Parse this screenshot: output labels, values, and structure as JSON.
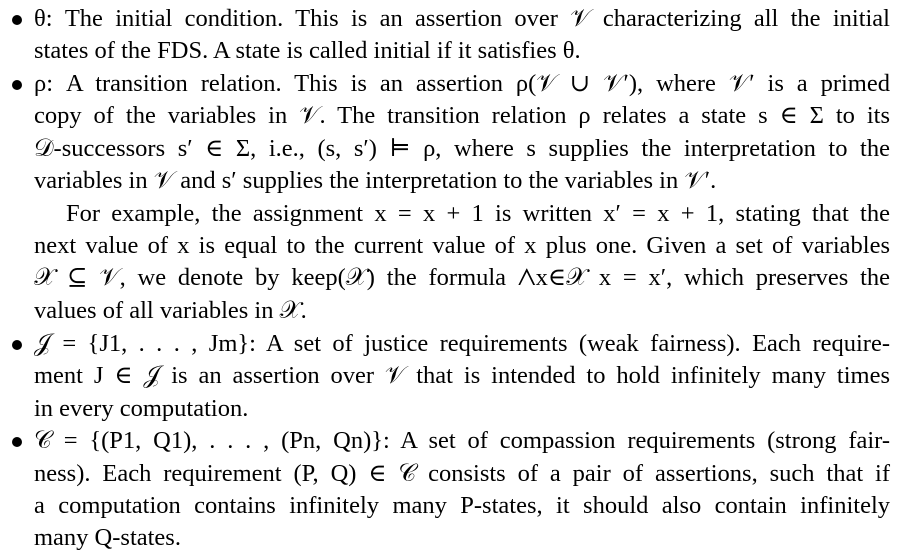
{
  "document": {
    "lines": [
      "θ: The initial condition. This is an assertion over 𝒱 characterizing all the initial",
      "states of the FDS. A state is called initial if it satisfies θ.",
      "ρ: A transition relation. This is an assertion ρ(𝒱 ∪ 𝒱′), where 𝒱′ is a primed",
      "copy of the variables in 𝒱. The transition relation ρ relates a state s ∈ Σ to its",
      "𝒟-successors s′ ∈ Σ, i.e., (s, s′) ⊨ ρ, where s supplies the interpretation to the",
      "variables in 𝒱 and s′ supplies the interpretation to the variables in 𝒱′.",
      "For example, the assignment x = x + 1 is written x′ = x + 1, stating that the",
      "next value of x is equal to the current value of x plus one. Given a set of variables",
      "𝒳 ⊆ 𝒱, we denote by keep(𝒳) the formula ⋀x∈𝒳 x = x′, which preserves the",
      "values of all variables in 𝒳.",
      "𝒥 = {J1, . . . , Jm}: A set of justice requirements (weak fairness). Each require-",
      "ment J ∈ 𝒥 is an assertion over 𝒱 that is intended to hold infinitely many times",
      "in every computation.",
      "𝒞 = {(P1, Q1), . . . , (Pn, Qn)}: A set of compassion requirements (strong fair-",
      "ness). Each requirement (P, Q) ∈ 𝒞 consists of a pair of assertions, such that if",
      "a computation contains infinitely many P-states, it should also contain infinitely",
      "many Q-states."
    ]
  }
}
